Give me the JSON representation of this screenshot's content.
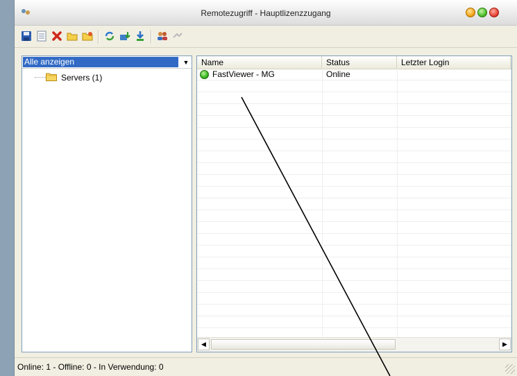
{
  "window": {
    "title": "Remotezugriff - Hauptlizenzzugang"
  },
  "toolbar": {
    "icons": [
      "save-icon",
      "properties-icon",
      "delete-icon",
      "new-folder-icon",
      "edit-folder-icon",
      "refresh-icon",
      "download-icon",
      "import-icon",
      "users-icon",
      "connect-icon"
    ]
  },
  "filter": {
    "selected": "Alle anzeigen"
  },
  "tree": {
    "items": [
      {
        "label": "Servers (1)"
      }
    ]
  },
  "table": {
    "columns": [
      "Name",
      "Status",
      "Letzter Login"
    ],
    "rows": [
      {
        "name": "FastViewer - MG",
        "status": "Online",
        "last_login": ""
      }
    ]
  },
  "statusbar": {
    "text": "Online: 1 - Offline: 0 - In Verwendung: 0"
  },
  "colors": {
    "online": "#36b51c",
    "selection": "#316ac5"
  }
}
